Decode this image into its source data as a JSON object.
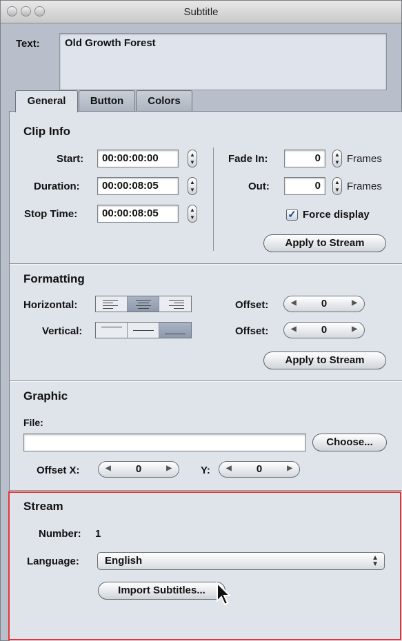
{
  "window": {
    "title": "Subtitle"
  },
  "text_field": {
    "label": "Text:",
    "value": "Old Growth Forest"
  },
  "tabs": [
    {
      "label": "General",
      "active": true
    },
    {
      "label": "Button",
      "active": false
    },
    {
      "label": "Colors",
      "active": false
    }
  ],
  "clip_info": {
    "heading": "Clip Info",
    "start": {
      "label": "Start:",
      "value": "00:00:00:00"
    },
    "duration": {
      "label": "Duration:",
      "value": "00:00:08:05"
    },
    "stop_time": {
      "label": "Stop Time:",
      "value": "00:00:08:05"
    },
    "fade_in": {
      "label": "Fade In:",
      "value": "0",
      "unit": "Frames"
    },
    "fade_out": {
      "label": "Out:",
      "value": "0",
      "unit": "Frames"
    },
    "force_display": {
      "label": "Force display",
      "checked": true
    },
    "apply_label": "Apply to Stream"
  },
  "formatting": {
    "heading": "Formatting",
    "horizontal_label": "Horizontal:",
    "vertical_label": "Vertical:",
    "horizontal_selected": "center",
    "vertical_selected": "bottom",
    "offset_h": {
      "label": "Offset:",
      "value": "0"
    },
    "offset_v": {
      "label": "Offset:",
      "value": "0"
    },
    "apply_label": "Apply to Stream"
  },
  "graphic": {
    "heading": "Graphic",
    "file_label": "File:",
    "file_value": "",
    "choose_label": "Choose...",
    "offset_x": {
      "label": "Offset X:",
      "value": "0"
    },
    "offset_y": {
      "label": "Y:",
      "value": "0"
    }
  },
  "stream": {
    "heading": "Stream",
    "number_label": "Number:",
    "number_value": "1",
    "language_label": "Language:",
    "language_value": "English",
    "import_label": "Import Subtitles..."
  },
  "colors": {
    "highlight": "#e4343a",
    "pane": "#dfe3ea",
    "chrome": "#b9bfca"
  }
}
